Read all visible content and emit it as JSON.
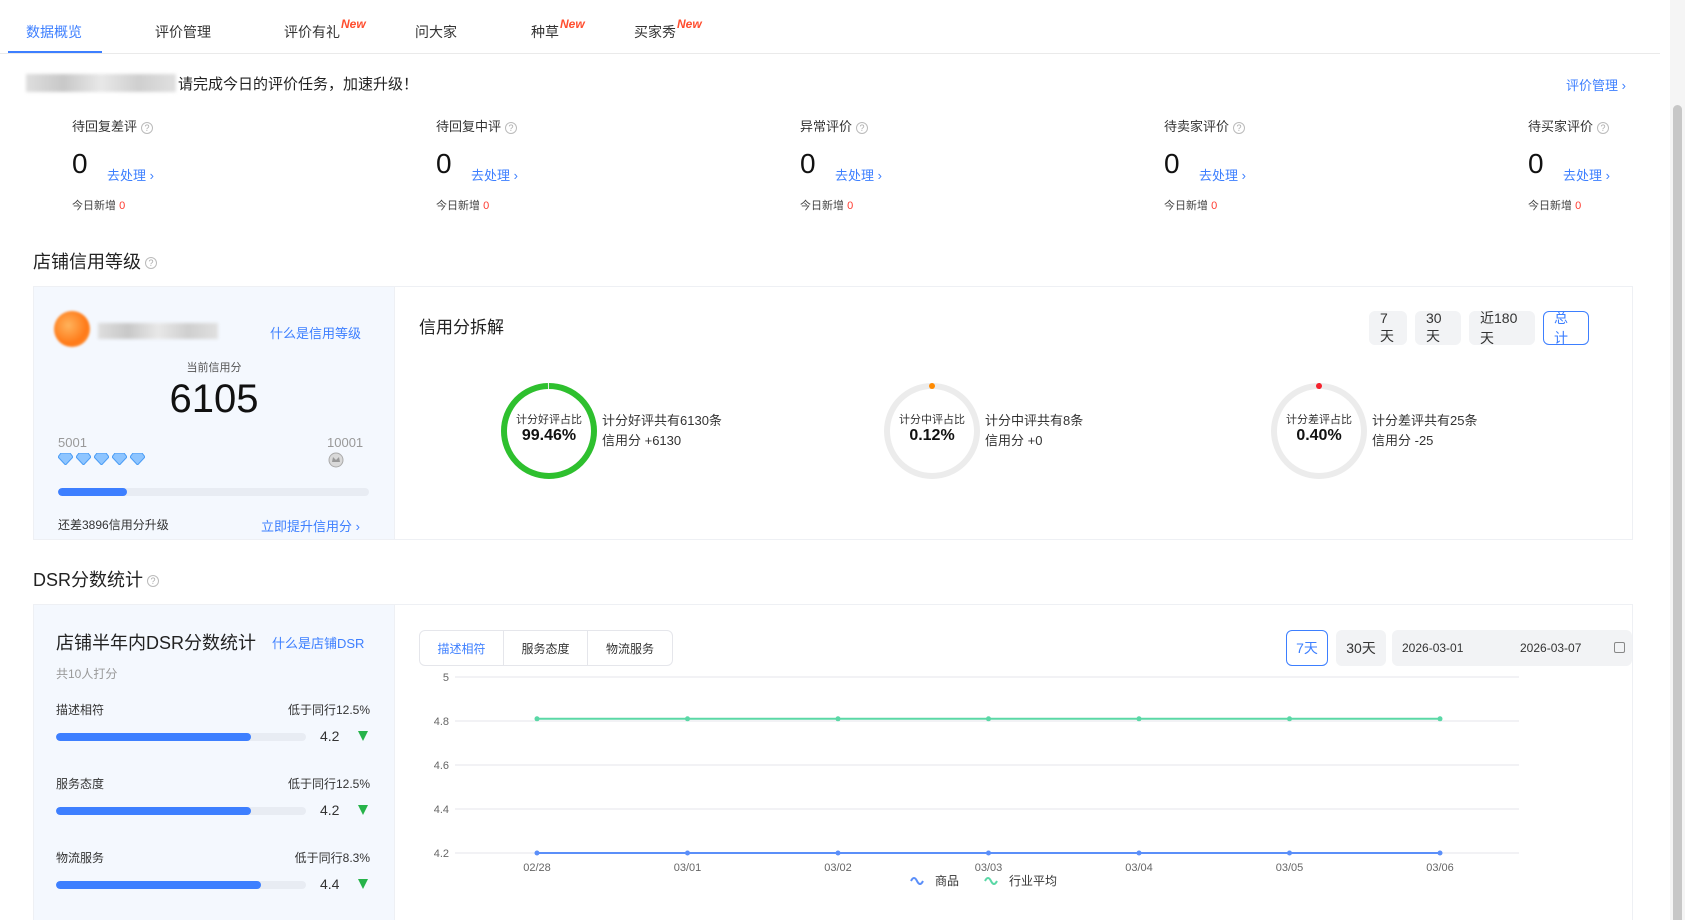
{
  "tabs": [
    {
      "label": "数据概览",
      "active": true,
      "new": false
    },
    {
      "label": "评价管理",
      "active": false,
      "new": false
    },
    {
      "label": "评价有礼",
      "active": false,
      "new": true
    },
    {
      "label": "问大家",
      "active": false,
      "new": false
    },
    {
      "label": "种草",
      "active": false,
      "new": true
    },
    {
      "label": "买家秀",
      "active": false,
      "new": true
    }
  ],
  "new_badge": "New",
  "notice": {
    "text": "请完成今日的评价任务，加速升级！"
  },
  "top_link": "评价管理 ›",
  "stats": [
    {
      "label": "待回复差评",
      "value": "0",
      "action": "去处理 ›",
      "today_label": "今日新增",
      "today_value": "0"
    },
    {
      "label": "待回复中评",
      "value": "0",
      "action": "去处理 ›",
      "today_label": "今日新增",
      "today_value": "0"
    },
    {
      "label": "异常评价",
      "value": "0",
      "action": "去处理 ›",
      "today_label": "今日新增",
      "today_value": "0"
    },
    {
      "label": "待卖家评价",
      "value": "0",
      "action": "去处理 ›",
      "today_label": "今日新增",
      "today_value": "0"
    },
    {
      "label": "待买家评价",
      "value": "0",
      "action": "去处理 ›",
      "today_label": "今日新增",
      "today_value": "0"
    }
  ],
  "credit": {
    "section_title": "店铺信用等级",
    "what_link": "什么是信用等级",
    "current_label": "当前信用分",
    "current_score": "6105",
    "range_min": "5001",
    "range_max": "10001",
    "progress_fraction": 0.2208,
    "need_text": "还差3896信用分升级",
    "raise_link": "立即提升信用分 ›",
    "breakdown_title": "信用分拆解",
    "periods": [
      "7天",
      "30天",
      "近180天",
      "总计"
    ],
    "active_period": "总计",
    "rings": [
      {
        "label": "计分好评占比",
        "value": "99.46%",
        "fraction": 0.9946,
        "color": "#2ec02e",
        "desc1": "计分好评共有6130条",
        "desc2": "信用分 +6130"
      },
      {
        "label": "计分中评占比",
        "value": "0.12%",
        "fraction": 0.0012,
        "color": "#ff8a00",
        "desc1": "计分中评共有8条",
        "desc2": "信用分 +0"
      },
      {
        "label": "计分差评占比",
        "value": "0.40%",
        "fraction": 0.004,
        "color": "#f5222d",
        "desc1": "计分差评共有25条",
        "desc2": "信用分 -25"
      }
    ]
  },
  "dsr": {
    "section_title": "DSR分数统计",
    "panel_title": "店铺半年内DSR分数统计",
    "what_link": "什么是店铺DSR",
    "raters": "共10人打分",
    "items": [
      {
        "name": "描述相符",
        "compare": "低于同行12.5%",
        "score": "4.2",
        "fraction": 0.78
      },
      {
        "name": "服务态度",
        "compare": "低于同行12.5%",
        "score": "4.2",
        "fraction": 0.78
      },
      {
        "name": "物流服务",
        "compare": "低于同行8.3%",
        "score": "4.4",
        "fraction": 0.82
      }
    ],
    "tabs": [
      "描述相符",
      "服务态度",
      "物流服务"
    ],
    "active_tab": "描述相符",
    "period_7": "7天",
    "period_30": "30天",
    "date_start": "2026-03-01",
    "date_end": "2026-03-07"
  },
  "chart_data": {
    "type": "line",
    "x": [
      "02/28",
      "03/01",
      "03/02",
      "03/03",
      "03/04",
      "03/05",
      "03/06"
    ],
    "ylim": [
      4.2,
      5
    ],
    "yticks": [
      "5",
      "4.8",
      "4.6",
      "4.4",
      "4.2"
    ],
    "series": [
      {
        "name": "商品",
        "color": "#5b8ff9",
        "values": [
          4.2,
          4.2,
          4.2,
          4.2,
          4.2,
          4.2,
          4.2
        ]
      },
      {
        "name": "行业平均",
        "color": "#5ad8a6",
        "values": [
          4.81,
          4.81,
          4.81,
          4.81,
          4.81,
          4.81,
          4.81
        ]
      }
    ],
    "grid": true,
    "legend": "bottom"
  }
}
